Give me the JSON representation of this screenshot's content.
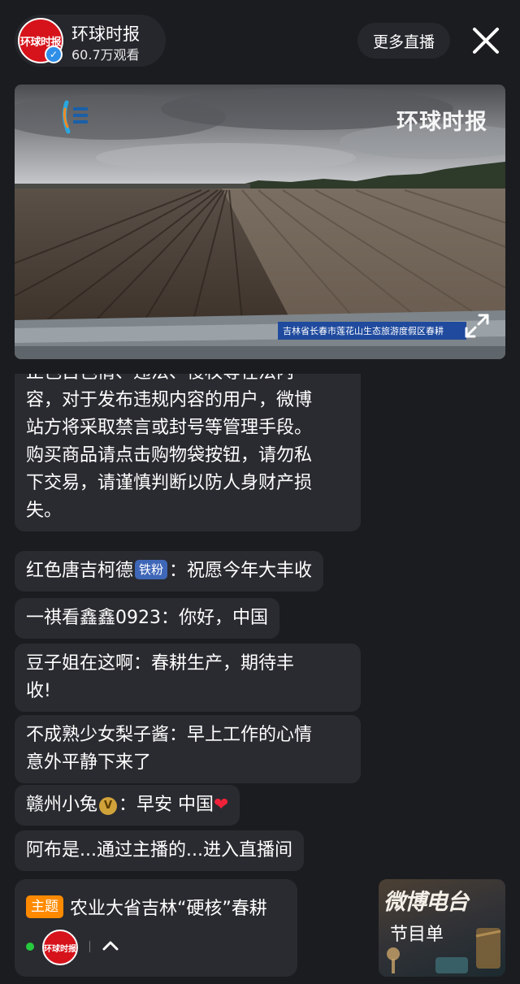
{
  "header": {
    "channel_name": "环球时报",
    "viewer_count": "60.7万观看",
    "avatar_logo_text": "环球时报",
    "more_live_label": "更多直播",
    "close_icon": "close-icon",
    "verified_icon": "verified-icon"
  },
  "video": {
    "watermark": "环球时报",
    "location_caption": "吉林省长春市莲花山生态旅游度假区春耕",
    "fullscreen_icon": "fullscreen-icon"
  },
  "comments": [
    {
      "type": "notice",
      "text": "止色古色情、违法、侵权等在法内容，对于发布违规内容的用户，微博站方将采取禁言或封号等管理手段。购买商品请点击购物袋按钮，请勿私下交易，请谨慎判断以防人身财产损失。",
      "lines": [
        "止色古色情、违法、侵权等在法内",
        "容，对于发布违规内容的用户，微博",
        "站方将采取禁言或封号等管理手段。",
        "购买商品请点击购物袋按钮，请勿私",
        "下交易，请谨慎判断以防人身财产损",
        "失。"
      ]
    },
    {
      "user": "红色唐吉柯德",
      "badge": "铁粉",
      "separator": "：",
      "text": "祝愿今年大丰收"
    },
    {
      "user": "一祺看鑫鑫0923",
      "separator": "：",
      "text": "你好，中国"
    },
    {
      "user": "豆子姐在这啊",
      "separator": "：",
      "text_line1": "春耕生产，期待丰",
      "text_line2": "收!"
    },
    {
      "user": "不成熟少女梨子酱",
      "separator": "：",
      "text_line1": "早上工作的心情",
      "text_line2": "意外平静下来了"
    },
    {
      "user": "赣州小兔",
      "badge_icon": "v-badge-icon",
      "separator": "：",
      "text": "早安 中国",
      "emoji": "❤"
    },
    {
      "text": "阿布是...通过主播的...进入直播间"
    }
  ],
  "topic": {
    "tag": "主题",
    "title": "农业大省吉林“硬核”春耕",
    "host_logo_text": "环球时报",
    "expand_icon": "chevron-up-icon"
  },
  "radio": {
    "title": "微博电台",
    "subtitle": "节目单"
  },
  "colors": {
    "background": "#1b1c20",
    "bubble": "#2a2b30",
    "brand_red": "#d6131b",
    "fan_badge": "#3f67b8",
    "topic_tag": "#ff8a00",
    "live_green": "#27c93f"
  }
}
